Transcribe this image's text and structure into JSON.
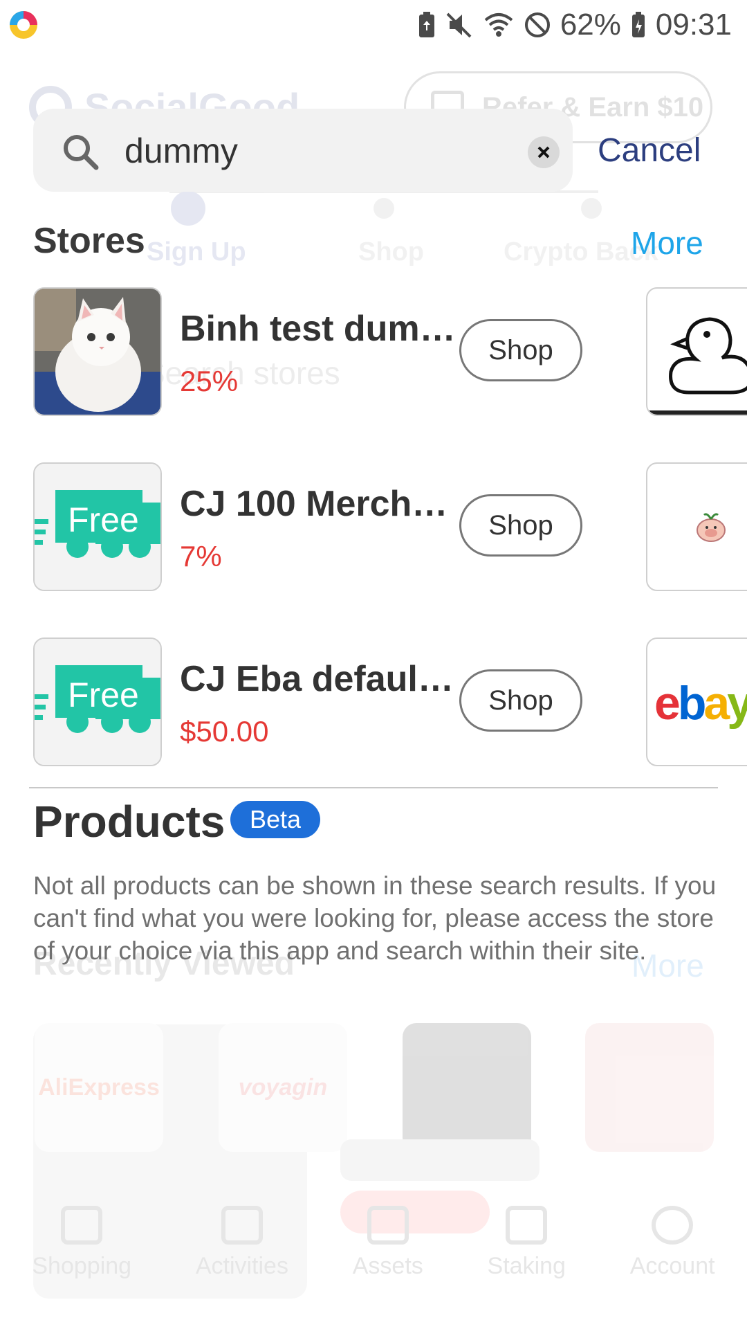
{
  "status_bar": {
    "battery_percent": "62%",
    "time": "09:31"
  },
  "background": {
    "brand": "SocialGood",
    "refer_label": "Refer & Earn $10",
    "steps": [
      "Sign Up",
      "Shop",
      "Crypto Back"
    ],
    "search_placeholder": "Search stores",
    "recently_viewed": "Recently Viewed",
    "more": "More",
    "tiles": [
      "AliExpress",
      "voyagin"
    ],
    "nav": [
      "Shopping",
      "Activities",
      "Assets",
      "Staking",
      "Account"
    ]
  },
  "search": {
    "query": "dummy",
    "cancel_label": "Cancel"
  },
  "stores": {
    "heading": "Stores",
    "more_label": "More",
    "items": [
      {
        "name": "Binh test dum…",
        "rate": "25%",
        "button": "Shop"
      },
      {
        "name": "CJ 100 Merch…",
        "rate": "7%",
        "button": "Shop"
      },
      {
        "name": "CJ Eba defaul…",
        "rate": "$50.00",
        "button": "Shop"
      }
    ],
    "free_logo_text": "Free",
    "ebay_letters": [
      "e",
      "b",
      "a",
      "y"
    ],
    "ebay_colors": [
      "#e53238",
      "#0064d2",
      "#f5af02",
      "#86b817"
    ]
  },
  "products": {
    "heading": "Products",
    "badge": "Beta",
    "note": "Not all products can be shown in these search results. If you can't find what you were looking for, please access the store of your choice via this app and search within their site."
  },
  "colors": {
    "accent_blue": "#1ea5e9",
    "cancel_navy": "#2c3e7f",
    "rate_red": "#e53935",
    "free_teal": "#22c5a6",
    "beta_blue": "#1e6fd9"
  }
}
